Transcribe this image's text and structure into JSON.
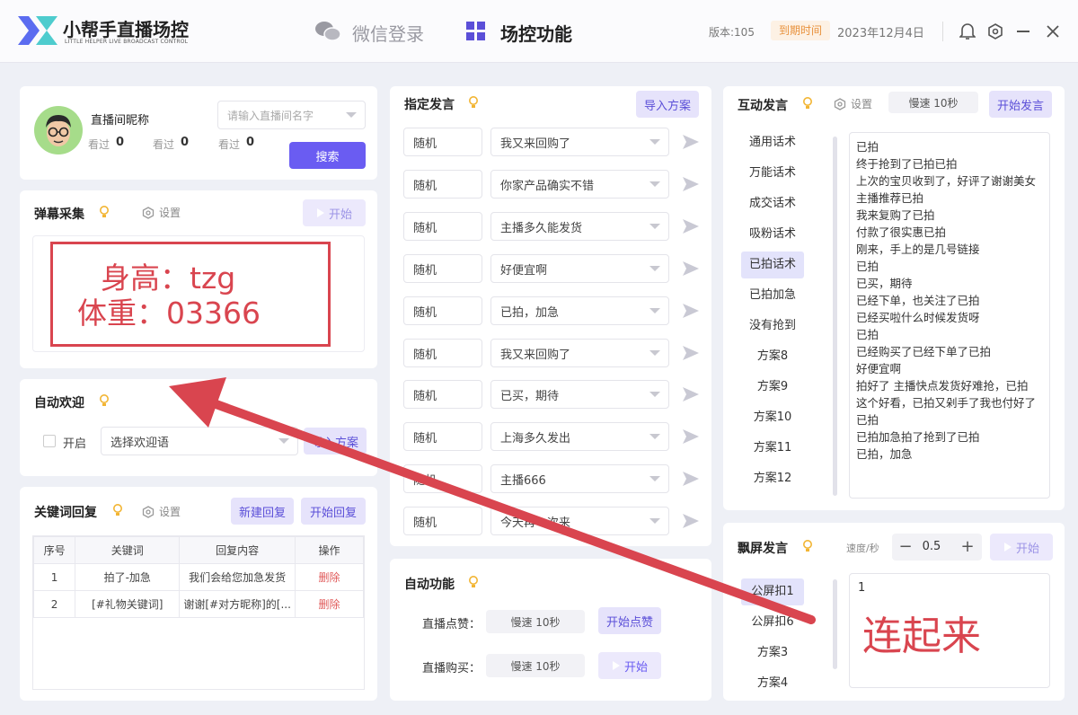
{
  "header": {
    "app_title": "小帮手直播场控",
    "app_subtitle": "LITTLE HELPER LIVE BROADCAST CONTROL",
    "tab_wechat_login": "微信登录",
    "tab_control": "场控功能",
    "version": "版本:105",
    "expire_badge": "到期时间",
    "expire_date": "2023年12月4日"
  },
  "profile": {
    "nickname": "直播间昵称",
    "stats": [
      {
        "label": "看过",
        "value": "0"
      },
      {
        "label": "看过",
        "value": "0"
      },
      {
        "label": "看过",
        "value": "0"
      }
    ],
    "room_input_placeholder": "请输入直播间名字",
    "search_button": "搜索"
  },
  "danmu": {
    "title": "弹幕采集",
    "settings": "设置",
    "start": "开始",
    "overlay_line1": "身高：tzg",
    "overlay_line2": "体重：03366"
  },
  "welcome": {
    "title": "自动欢迎",
    "enable_label": "开启",
    "select_placeholder": "选择欢迎语",
    "import_button": "导入方案"
  },
  "keyword": {
    "title": "关键词回复",
    "settings": "设置",
    "new_button": "新建回复",
    "start_button": "开始回复",
    "columns": [
      "序号",
      "关键词",
      "回复内容",
      "操作"
    ],
    "rows": [
      {
        "no": "1",
        "keyword": "拍了-加急",
        "content": "我们会给您加急发货",
        "action": "删除"
      },
      {
        "no": "2",
        "keyword": "[#礼物关键词]",
        "content": "谢谢[#对方昵称]的[...",
        "action": "删除"
      }
    ]
  },
  "designated": {
    "title": "指定发言",
    "import_button": "导入方案",
    "rows": [
      {
        "mode": "随机",
        "text": "我又来回购了"
      },
      {
        "mode": "随机",
        "text": "你家产品确实不错"
      },
      {
        "mode": "随机",
        "text": "主播多久能发货"
      },
      {
        "mode": "随机",
        "text": "好便宜啊"
      },
      {
        "mode": "随机",
        "text": "已拍，加急"
      },
      {
        "mode": "随机",
        "text": "我又来回购了"
      },
      {
        "mode": "随机",
        "text": "已买，期待"
      },
      {
        "mode": "随机",
        "text": "上海多久发出"
      },
      {
        "mode": "随机",
        "text": "主播666"
      },
      {
        "mode": "随机",
        "text": "今天再一次来"
      }
    ]
  },
  "auto": {
    "title": "自动功能",
    "like_label": "直播点赞：",
    "like_speed": "慢速 10秒",
    "like_button": "开始点赞",
    "buy_label": "直播购买：",
    "buy_speed": "慢速 10秒",
    "buy_button": "开始"
  },
  "interact": {
    "title": "互动发言",
    "settings": "设置",
    "speed": "慢速 10秒",
    "start_button": "开始发言",
    "categories": [
      "通用话术",
      "万能话术",
      "成交话术",
      "吸粉话术",
      "已拍话术",
      "已拍加急",
      "没有抢到",
      "方案8",
      "方案9",
      "方案10",
      "方案11",
      "方案12"
    ],
    "active_category": "已拍话术",
    "lines": [
      "已拍",
      "终于抢到了已拍已拍",
      "上次的宝贝收到了，好评了谢谢美女",
      "主播推荐已拍",
      "我来复购了已拍",
      "付款了很实惠已拍",
      "刚来，手上的是几号链接",
      "已拍",
      "已买，期待",
      "已经下单，也关注了已拍",
      "已经买啦什么时候发货呀",
      "已拍",
      "已经购买了已经下单了已拍",
      "好便宜啊",
      "拍好了 主播快点发货好难抢，已拍",
      "这个好看，已拍又剁手了我也付好了",
      "已拍",
      "已拍加急拍了抢到了已拍",
      "已拍，加急"
    ]
  },
  "floating": {
    "title": "飘屏发言",
    "speed_label": "速度/秒",
    "speed_value": "0.5",
    "start_button": "开始",
    "categories": [
      "公屏扣1",
      "公屏扣6",
      "方案3",
      "方案4"
    ],
    "active_category": "公屏扣1",
    "content": "1",
    "overlay_text": "连起来"
  },
  "colors": {
    "accent": "#6a5cf2",
    "annotation_red": "#d9454f"
  }
}
